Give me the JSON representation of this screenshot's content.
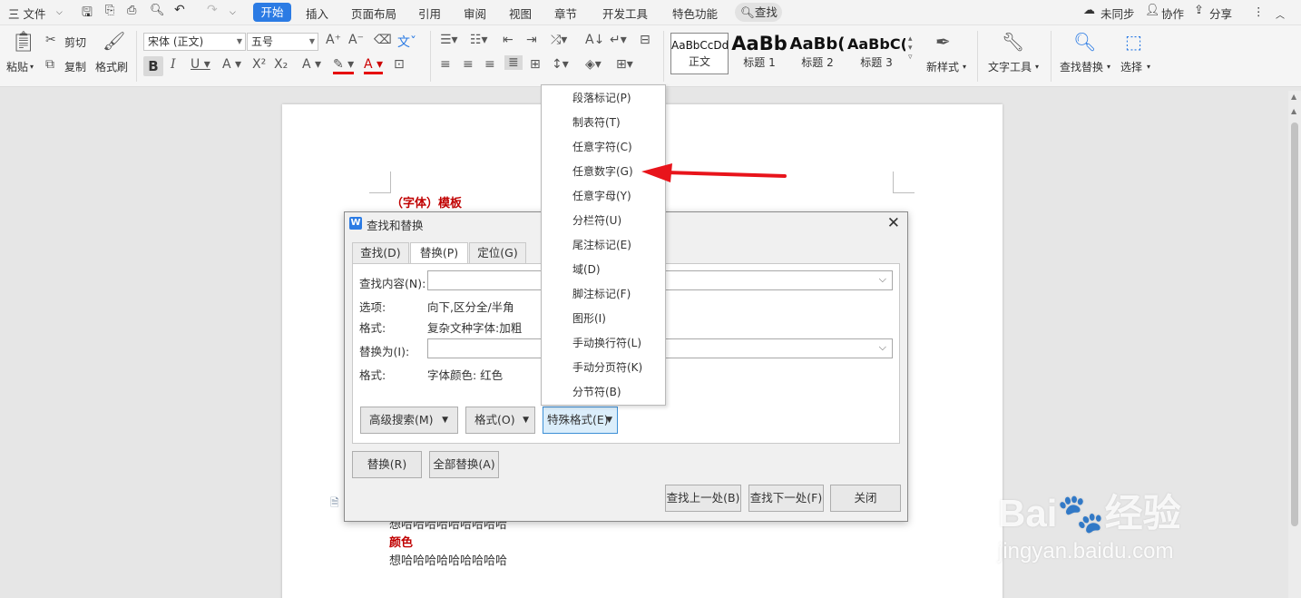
{
  "menubar": {
    "file": "三 文件",
    "tabs": [
      "开始",
      "插入",
      "页面布局",
      "引用",
      "审阅",
      "视图",
      "章节",
      "开发工具",
      "特色功能"
    ],
    "search": "查找",
    "right": [
      "未同步",
      "协作",
      "分享"
    ]
  },
  "ribbon": {
    "paste": "粘贴",
    "cut": "剪切",
    "copy": "复制",
    "format_painter": "格式刷",
    "font_name": "宋体 (正文)",
    "font_size": "五号",
    "styles": [
      {
        "sample": "AaBbCcDd",
        "name": "正文"
      },
      {
        "sample": "AaBb",
        "name": "标题 1"
      },
      {
        "sample": "AaBb(",
        "name": "标题 2"
      },
      {
        "sample": "AaBbC(",
        "name": "标题 3"
      }
    ],
    "new_style": "新样式",
    "text_tools": "文字工具",
    "find_replace": "查找替换",
    "select": "选择"
  },
  "document": {
    "heading": "（字体）模板",
    "line1": "想哈哈哈哈哈哈哈哈哈",
    "color_label": "颜色",
    "line2": "想哈哈哈哈哈哈哈哈哈"
  },
  "dialog": {
    "title": "查找和替换",
    "tabs": [
      "查找(D)",
      "替换(P)",
      "定位(G)"
    ],
    "find_label": "查找内容(N):",
    "options_label": "选项:",
    "options_value": "向下,区分全/半角",
    "format_label": "格式:",
    "format_value": "复杂文种字体:加粗",
    "replace_label": "替换为(I):",
    "format2_label": "格式:",
    "format2_value": "字体颜色: 红色",
    "advanced_button": "高级搜索(M)",
    "format_button": "格式(O)",
    "special_button": "特殊格式(E)",
    "replace_button": "替换(R)",
    "replace_all_button": "全部替换(A)",
    "find_prev_button": "查找上一处(B)",
    "find_next_button": "查找下一处(F)",
    "close_button": "关闭"
  },
  "special_menu": [
    "段落标记(P)",
    "制表符(T)",
    "任意字符(C)",
    "任意数字(G)",
    "任意字母(Y)",
    "分栏符(U)",
    "尾注标记(E)",
    "域(D)",
    "脚注标记(F)",
    "图形(I)",
    "手动换行符(L)",
    "手动分页符(K)",
    "分节符(B)"
  ],
  "watermark": {
    "line1": "Bai🐾经验",
    "line2": "jingyan.baidu.com"
  }
}
